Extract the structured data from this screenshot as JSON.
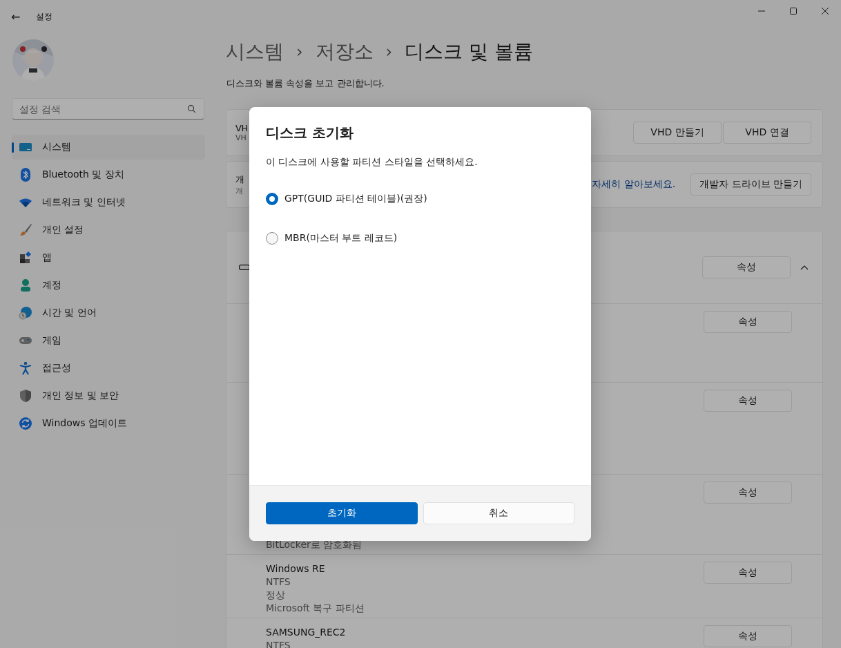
{
  "window": {
    "title": "설정",
    "back": "←"
  },
  "sidebar": {
    "search": {
      "placeholder": "설정 검색"
    },
    "items": [
      {
        "label": "시스템",
        "selected": true
      },
      {
        "label": "Bluetooth 및 장치",
        "selected": false
      },
      {
        "label": "네트워크 및 인터넷",
        "selected": false
      },
      {
        "label": "개인 설정",
        "selected": false
      },
      {
        "label": "앱",
        "selected": false
      },
      {
        "label": "계정",
        "selected": false
      },
      {
        "label": "시간 및 언어",
        "selected": false
      },
      {
        "label": "게임",
        "selected": false
      },
      {
        "label": "접근성",
        "selected": false
      },
      {
        "label": "개인 정보 및 보안",
        "selected": false
      },
      {
        "label": "Windows 업데이트",
        "selected": false
      }
    ]
  },
  "breadcrumb": [
    {
      "label": "시스템"
    },
    {
      "separator": "›",
      "label": "저장소"
    },
    {
      "separator": "›",
      "label": "디스크 및 볼륨"
    }
  ],
  "description": "디스크와 볼륨 속성을 보고 관리합니다.",
  "cards": [
    {
      "title": "VH",
      "subtitle": "VH",
      "buttons": [
        "VHD 만들기",
        "VHD 연결"
      ]
    },
    {
      "title": "개",
      "subtitle": "개",
      "link": "자세히 알아보세요.",
      "buttons": [
        "개발자 드라이브 만들기"
      ]
    }
  ],
  "disk": {
    "button": "속성",
    "expanded": true,
    "volumes": [
      {
        "button": "속성"
      },
      {
        "button": "속성"
      },
      {
        "lines": [
          "BitLocker로 암호화됨"
        ],
        "button": "속성"
      },
      {
        "lines": [
          "Windows RE",
          "NTFS",
          "정상",
          "Microsoft 복구 파티션"
        ],
        "button": "속성"
      },
      {
        "lines": [
          "SAMSUNG_REC2",
          "NTFS"
        ],
        "button": "속성"
      }
    ]
  },
  "dialog": {
    "title": "디스크 초기화",
    "message": "이 디스크에 사용할 파티션 스타일을 선택하세요.",
    "options": [
      {
        "label": "GPT(GUID 파티션 테이블)(권장)",
        "selected": true
      },
      {
        "label": "MBR(마스터 부트 레코드)",
        "selected": false
      }
    ],
    "primary": "초기화",
    "secondary": "취소"
  }
}
